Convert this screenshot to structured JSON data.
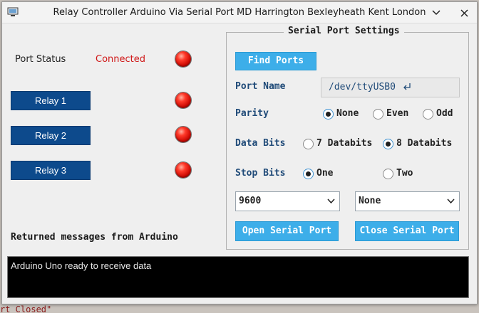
{
  "window": {
    "title": "Relay Controller Arduino Via Serial Port MD Harrington Bexleyheath Kent London",
    "icon": "monitor-icon",
    "minimize_icon": "chevron-down-icon",
    "close_icon": "close-icon"
  },
  "background_code": {
    "bottom_text": "rt Closed\""
  },
  "status": {
    "label": "Port Status",
    "value": "Connected",
    "value_color": "#d01818"
  },
  "relays": [
    {
      "label": "Relay 1"
    },
    {
      "label": "Relay 2"
    },
    {
      "label": "Relay 3"
    }
  ],
  "led_color": "#e01010",
  "messages": {
    "label": "Returned messages from Arduino",
    "console_text": "Arduino Uno ready to receive data"
  },
  "serial_settings": {
    "title": "Serial Port Settings",
    "find_ports_label": "Find Ports",
    "port_name_label": "Port Name",
    "port_name_value": "/dev/ttyUSB0",
    "port_name_suffix_icon": "return-arrow-icon",
    "parity_label": "Parity",
    "parity_options": [
      {
        "label": "None",
        "checked": true
      },
      {
        "label": "Even",
        "checked": false
      },
      {
        "label": "Odd",
        "checked": false
      }
    ],
    "data_bits_label": "Data Bits",
    "data_bits_options": [
      {
        "label": "7 Databits",
        "checked": false
      },
      {
        "label": "8 Databits",
        "checked": true
      }
    ],
    "stop_bits_label": "Stop Bits",
    "stop_bits_options": [
      {
        "label": "One",
        "checked": true
      },
      {
        "label": "Two",
        "checked": false
      }
    ],
    "baud_rate_value": "9600",
    "flow_control_value": "None",
    "open_label": "Open Serial Port",
    "close_label": "Close Serial Port",
    "accent_color": "#3daee9",
    "label_color": "#1f4a78"
  }
}
